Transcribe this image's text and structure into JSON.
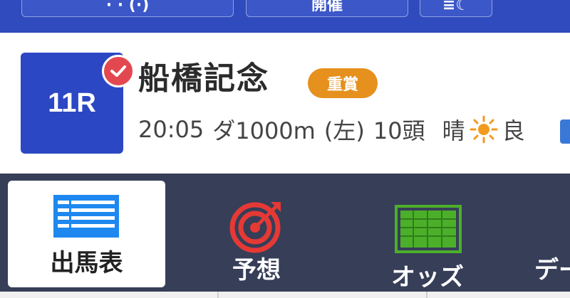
{
  "top_bar": {
    "buttons": [
      "· · (·)",
      "開催",
      "≡☾"
    ]
  },
  "race": {
    "number": "11R",
    "name": "船橋記念",
    "grade": "重賞",
    "time": "20:05",
    "course": "ダ1000m",
    "direction": "(左)",
    "runners": "10頭",
    "weather": "晴",
    "weather_icon": "sun-icon",
    "track_condition": "良"
  },
  "nav": {
    "items": [
      {
        "label": "出馬表",
        "icon": "list-icon",
        "active": true
      },
      {
        "label": "予想",
        "icon": "target-icon",
        "active": false
      },
      {
        "label": "オッズ",
        "icon": "grid-icon",
        "active": false
      },
      {
        "label": "デー",
        "icon": "data-icon",
        "active": false
      }
    ]
  },
  "colors": {
    "top_bar": "#2f4bbd",
    "race_badge": "#2c47c4",
    "check_badge": "#e34850",
    "grade_badge": "#e6901d",
    "nav_background": "#363e58",
    "list_icon": "#1e88f0",
    "target_icon": "#e53935",
    "grid_icon": "#4caf2a"
  }
}
